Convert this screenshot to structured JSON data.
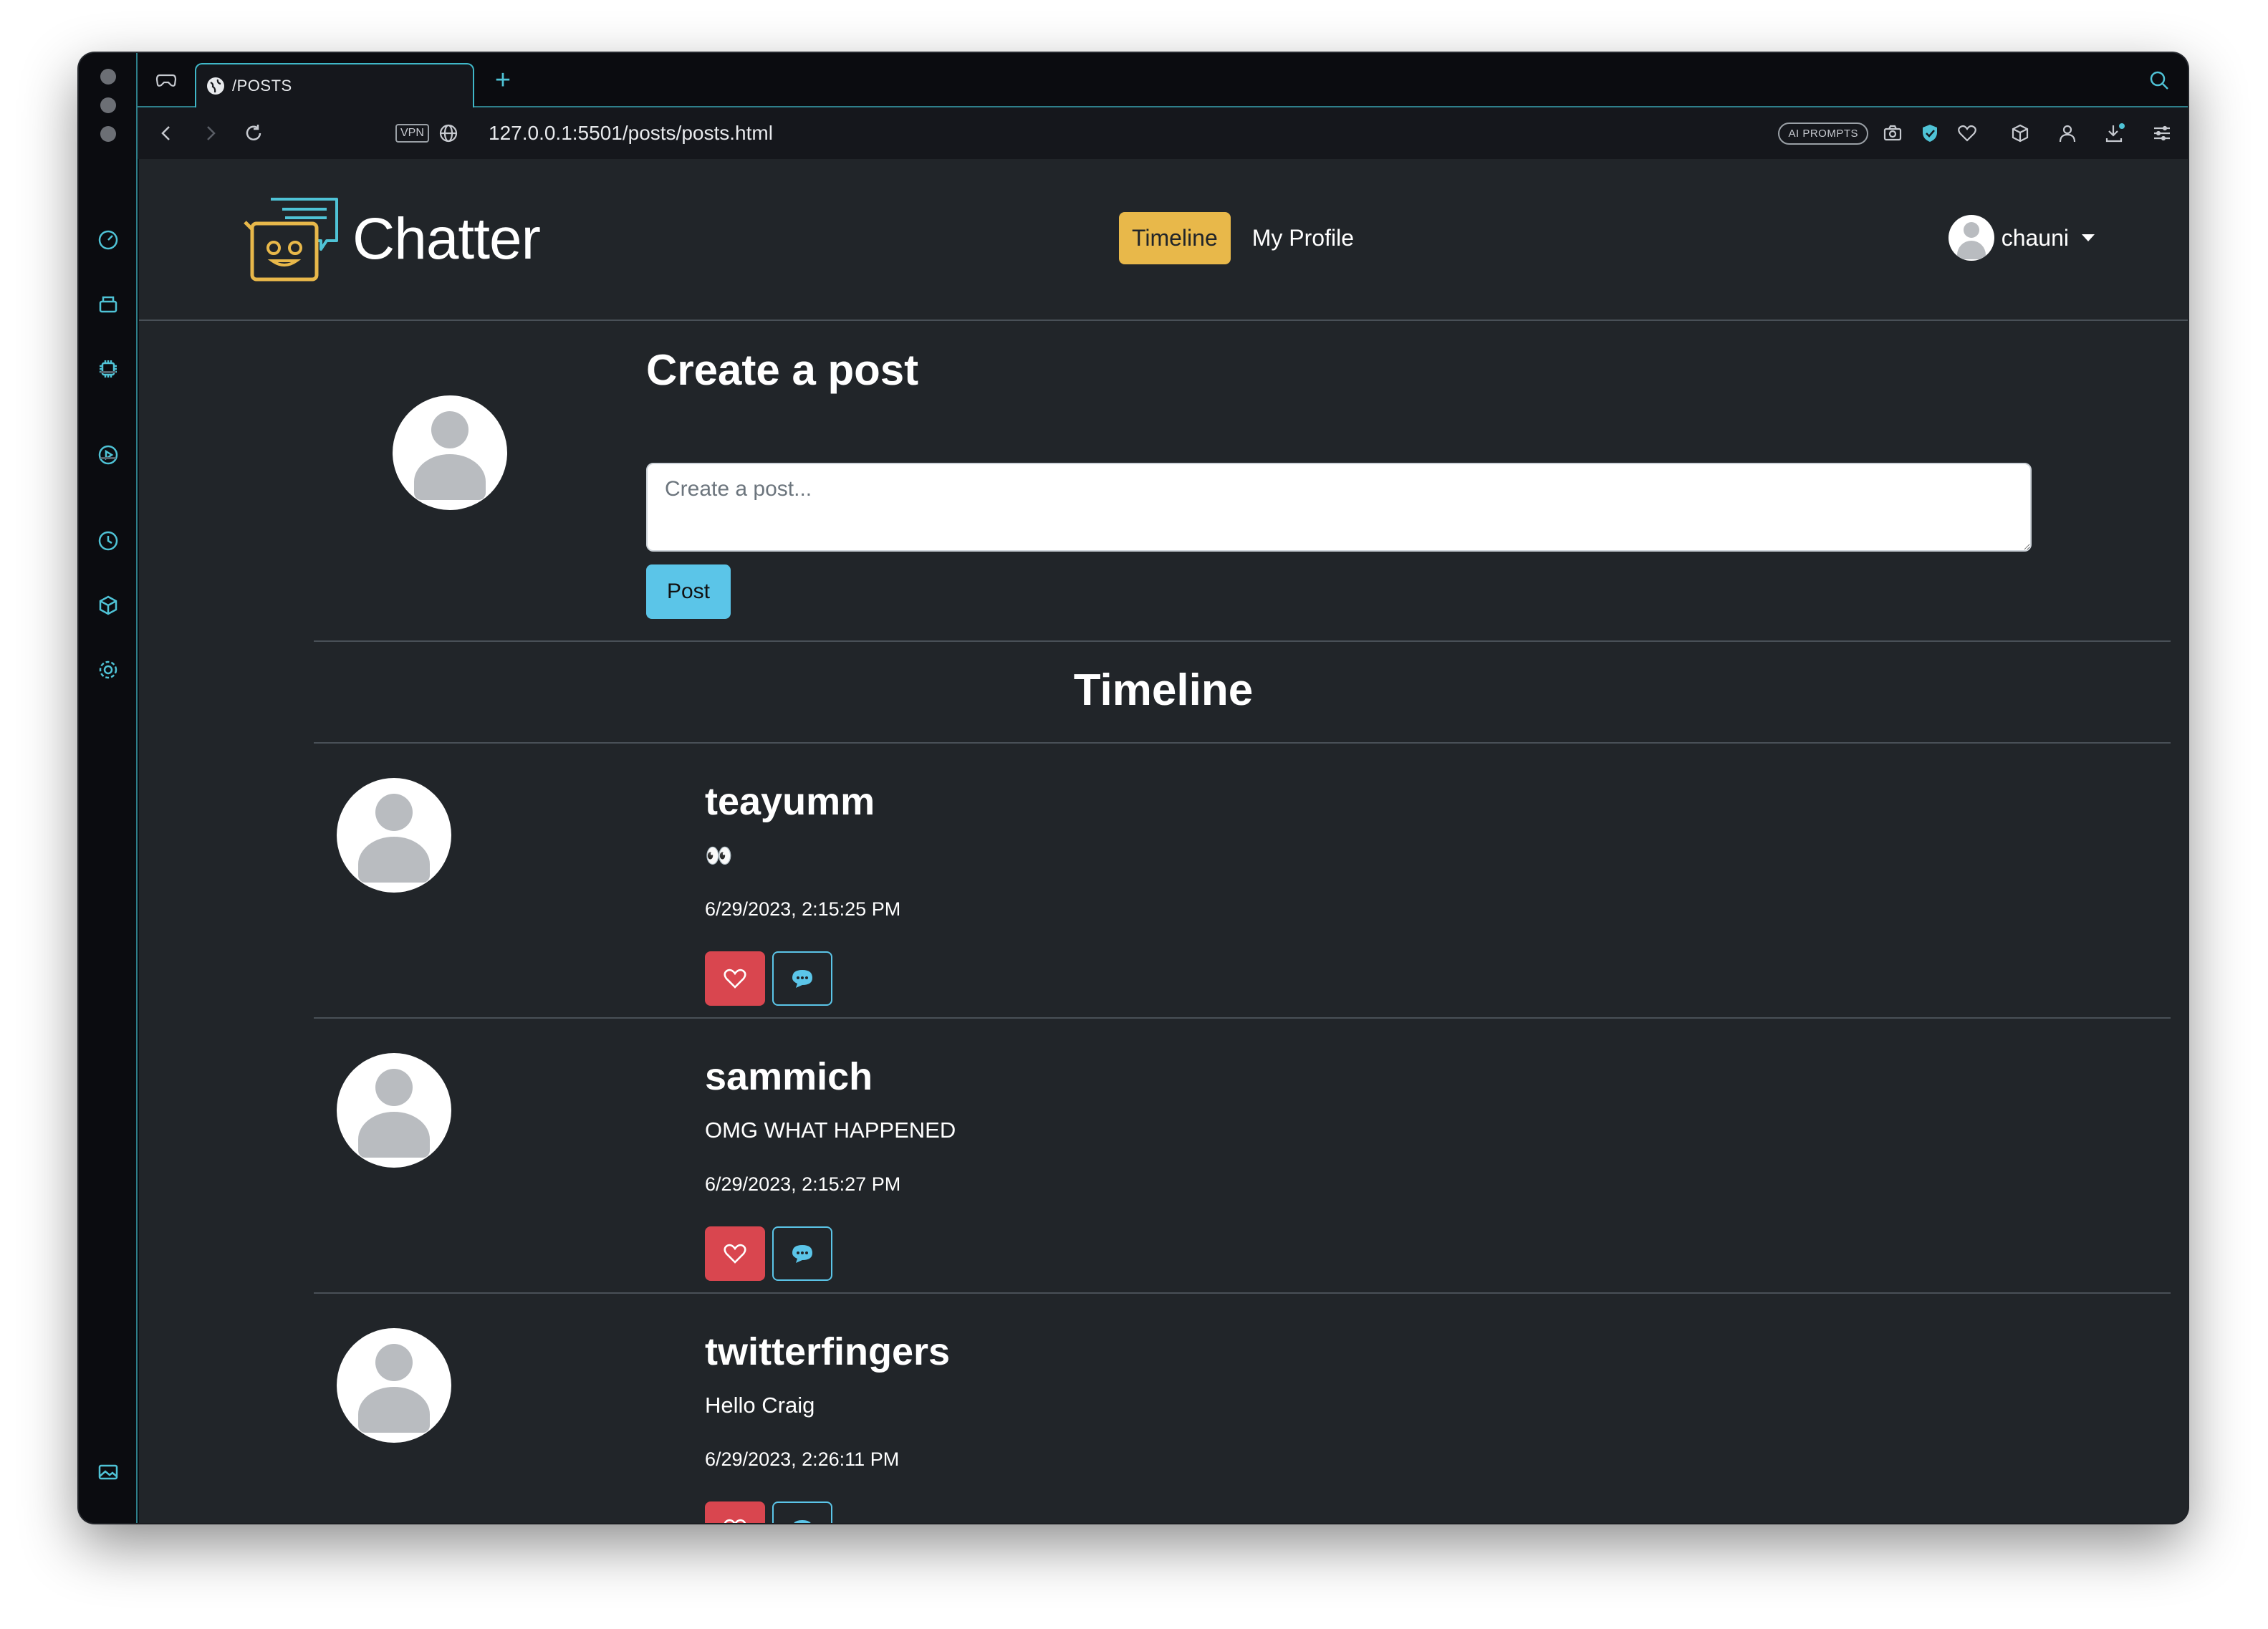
{
  "browser": {
    "tab_title": "/POSTS",
    "url": "127.0.0.1:5501/posts/posts.html",
    "vpn_label": "VPN",
    "ai_prompts_label": "AI PROMPTS"
  },
  "navbar": {
    "brand": "Chatter",
    "links": [
      {
        "label": "Timeline",
        "active": true
      },
      {
        "label": "My Profile",
        "active": false
      }
    ],
    "username": "chauni"
  },
  "create_post": {
    "title": "Create a post",
    "placeholder": "Create a post...",
    "button_label": "Post"
  },
  "timeline": {
    "title": "Timeline",
    "posts": [
      {
        "username": "teayumm",
        "content": "👀",
        "timestamp": "6/29/2023, 2:15:25 PM"
      },
      {
        "username": "sammich",
        "content": "OMG WHAT HAPPENED",
        "timestamp": "6/29/2023, 2:15:27 PM"
      },
      {
        "username": "twitterfingers",
        "content": "Hello Craig",
        "timestamp": "6/29/2023, 2:26:11 PM"
      }
    ]
  },
  "colors": {
    "page_bg": "#212529",
    "active_nav": "#e8b84a",
    "post_button": "#5bc5e8",
    "like_button": "#d9464f",
    "browser_accent": "#3fb7c8"
  }
}
